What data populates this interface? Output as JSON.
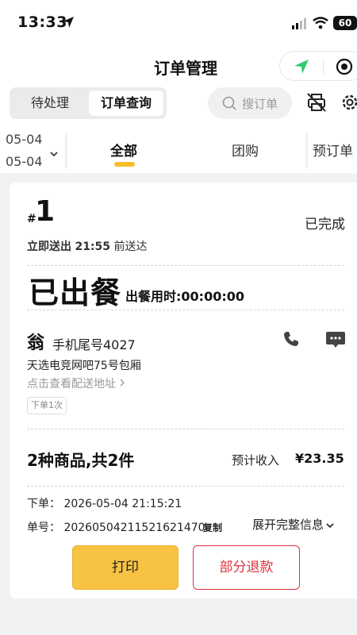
{
  "status_bar": {
    "time": "13:33",
    "battery": "60"
  },
  "nav": {
    "title": "订单管理"
  },
  "segment": {
    "pending": "待处理",
    "query": "订单查询"
  },
  "search": {
    "placeholder": "搜订单"
  },
  "filter": {
    "date_start": "05-04",
    "date_end": "05-04",
    "tabs": [
      "全部",
      "团购",
      "预订单"
    ],
    "active_tab": "全部"
  },
  "order": {
    "hash": "#",
    "number": "1",
    "status": "已完成",
    "deliver_prefix": "立即送出",
    "deliver_time": "21:55",
    "deliver_suffix": "前送达",
    "meal_state": "已出餐",
    "meal_time": "出餐用时:00:00:00",
    "customer_surname": "翁",
    "customer_phone": "手机尾号4027",
    "address": "天选电竞网吧75号包厢",
    "address_link": "点击查看配送地址",
    "order_count_badge": "下单1次",
    "goods_summary": "2种商品,共2件",
    "income_label": "预计收入",
    "income_value": "¥23.35",
    "order_time": "下单：  2026-05-04 21:15:21",
    "order_id": "单号：  20260504211521621470",
    "copy_label": "复制",
    "expand_label": "展开完整信息",
    "print_label": "打印",
    "refund_label": "部分退款"
  },
  "colors": {
    "accent": "#f8c242",
    "danger": "#e0323a",
    "nav_green": "#2ecc71"
  }
}
